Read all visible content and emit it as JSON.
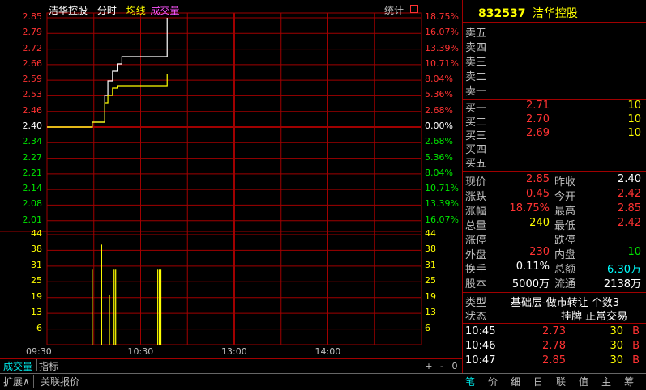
{
  "header": {
    "stock_name": "洁华控股",
    "mode_label": "分时",
    "avg_label": "均线",
    "vol_label": "成交量",
    "stats_label": "统计"
  },
  "price_axis": {
    "left_up": [
      "2.85",
      "2.79",
      "2.72",
      "2.66",
      "2.59",
      "2.53",
      "2.46"
    ],
    "left_mid": "2.40",
    "left_down": [
      "2.34",
      "2.27",
      "2.21",
      "2.14",
      "2.08",
      "2.01"
    ],
    "right_up": [
      "18.75%",
      "16.07%",
      "13.39%",
      "10.71%",
      "8.04%",
      "5.36%",
      "2.68%"
    ],
    "right_mid": "0.00%",
    "right_down": [
      "2.68%",
      "5.36%",
      "8.04%",
      "10.71%",
      "13.39%",
      "16.07%"
    ]
  },
  "volume_axis": [
    "44",
    "38",
    "31",
    "25",
    "19",
    "13",
    "6"
  ],
  "time_axis": [
    "09:30",
    "10:30",
    "13:00",
    "14:00"
  ],
  "colors": {
    "up": "#ff3232",
    "down": "#00e600",
    "price_line": "#ffffff",
    "avg_line": "#ffff00",
    "grid": "#a00000"
  },
  "bottom_tabs": {
    "volume": "成交量",
    "indicator": "指标",
    "plus": "+",
    "minus": "-",
    "zero": "0"
  },
  "footer_tabs": {
    "expand": "扩展∧",
    "related": "关联报价"
  },
  "panel": {
    "code": "832537",
    "name": "洁华控股",
    "sell": [
      {
        "label": "卖五",
        "price": "",
        "vol": ""
      },
      {
        "label": "卖四",
        "price": "",
        "vol": ""
      },
      {
        "label": "卖三",
        "price": "",
        "vol": ""
      },
      {
        "label": "卖二",
        "price": "",
        "vol": ""
      },
      {
        "label": "卖一",
        "price": "",
        "vol": ""
      }
    ],
    "buy": [
      {
        "label": "买一",
        "price": "2.71",
        "vol": "10"
      },
      {
        "label": "买二",
        "price": "2.70",
        "vol": "10"
      },
      {
        "label": "买三",
        "price": "2.69",
        "vol": "10"
      },
      {
        "label": "买四",
        "price": "",
        "vol": ""
      },
      {
        "label": "买五",
        "price": "",
        "vol": ""
      }
    ],
    "stats": {
      "now_label": "现价",
      "now": "2.85",
      "prev_label": "昨收",
      "prev": "2.40",
      "chg_label": "涨跌",
      "chg": "0.45",
      "open_label": "今开",
      "open": "2.42",
      "pct_label": "涨幅",
      "pct": "18.75%",
      "high_label": "最高",
      "high": "2.85",
      "vol_label": "总量",
      "vol": "240",
      "low_label": "最低",
      "low": "2.42",
      "limup_label": "涨停",
      "limdn_label": "跌停",
      "outer_label": "外盘",
      "outer": "230",
      "inner_label": "内盘",
      "inner": "10",
      "turn_label": "换手",
      "turn": "0.11%",
      "amt_label": "总额",
      "amt": "6.30万",
      "cap_label": "股本",
      "cap": "5000万",
      "float_label": "流通",
      "float": "2138万"
    },
    "type_label": "类型",
    "type_value": "基础层-做市转让 个数3",
    "state_label": "状态",
    "state_value": "挂牌 正常交易",
    "ticks": [
      {
        "time": "10:45",
        "price": "2.73",
        "vol": "30",
        "side": "B"
      },
      {
        "time": "10:46",
        "price": "2.78",
        "vol": "30",
        "side": "B"
      },
      {
        "time": "10:47",
        "price": "2.85",
        "vol": "30",
        "side": "B"
      }
    ],
    "tabs": [
      "笔",
      "价",
      "细",
      "日",
      "联",
      "值",
      "主",
      "筹"
    ]
  },
  "chart_data": {
    "type": "line",
    "title": "洁华控股 分时",
    "prev_close": 2.4,
    "ylim": [
      2.01,
      2.85
    ],
    "x": [
      "09:30",
      "09:56",
      "09:59",
      "10:07",
      "10:09",
      "10:12",
      "10:15",
      "10:18",
      "10:43",
      "10:47"
    ],
    "series": [
      {
        "name": "price",
        "values": [
          2.4,
          2.4,
          2.42,
          2.53,
          2.59,
          2.63,
          2.66,
          2.69,
          2.69,
          2.85
        ]
      },
      {
        "name": "均线",
        "values": [
          2.4,
          2.4,
          2.42,
          2.5,
          2.53,
          2.56,
          2.57,
          2.57,
          2.57,
          2.62
        ]
      }
    ],
    "volume": {
      "x": [
        "09:59",
        "10:05",
        "10:10",
        "10:13",
        "10:14",
        "10:41",
        "10:42",
        "10:43"
      ],
      "values": [
        30,
        40,
        20,
        30,
        30,
        30,
        30,
        30
      ],
      "ylim": [
        0,
        44
      ]
    }
  }
}
